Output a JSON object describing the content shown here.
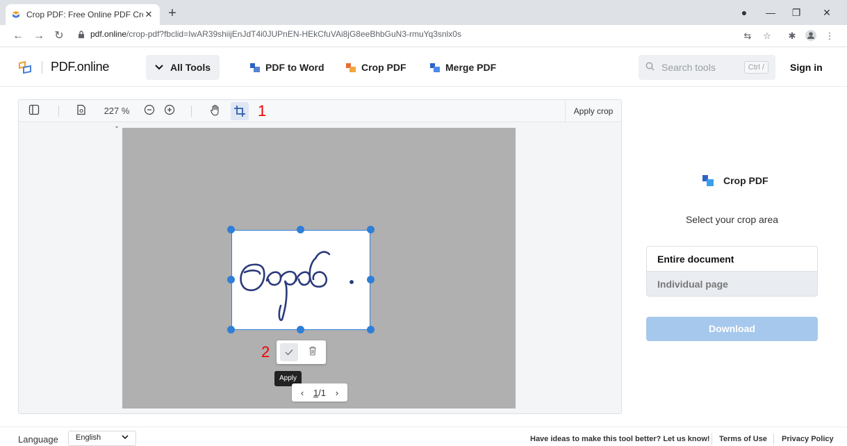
{
  "browser": {
    "tab_title": "Crop PDF: Free Online PDF Cropp",
    "tab_close": "✕",
    "new_tab": "+",
    "url_host": "pdf.online",
    "url_path": "/crop-pdf?fbclid=IwAR39shiijEnJdT4i0JUPnEN-HEkCfuVAi8jG8eeBhbGuN3-rmuYq3snlx0s"
  },
  "header": {
    "logo_text": "PDF.online",
    "all_tools": "All Tools",
    "nav": [
      "PDF to Word",
      "Crop PDF",
      "Merge PDF"
    ],
    "search_placeholder": "Search tools",
    "search_shortcut": "Ctrl /",
    "sign_in": "Sign in"
  },
  "viewer": {
    "zoom": "227 %",
    "apply_crop": "Apply crop",
    "marker_1": "1",
    "marker_2": "2",
    "tooltip": "Apply",
    "page_current": "1",
    "page_total": "1"
  },
  "panel": {
    "title": "Crop PDF",
    "subtitle": "Select your crop area",
    "options": [
      "Entire document",
      "Individual page"
    ],
    "download": "Download"
  },
  "footer": {
    "language_label": "Language",
    "language_value": "English",
    "feedback": "Have ideas to make this tool better? Let us know!",
    "terms": "Terms of Use",
    "privacy": "Privacy Policy"
  },
  "colors": {
    "accent": "#2f7ed8",
    "download_disabled": "#a6c8ec",
    "marker_red": "#ee0000"
  }
}
